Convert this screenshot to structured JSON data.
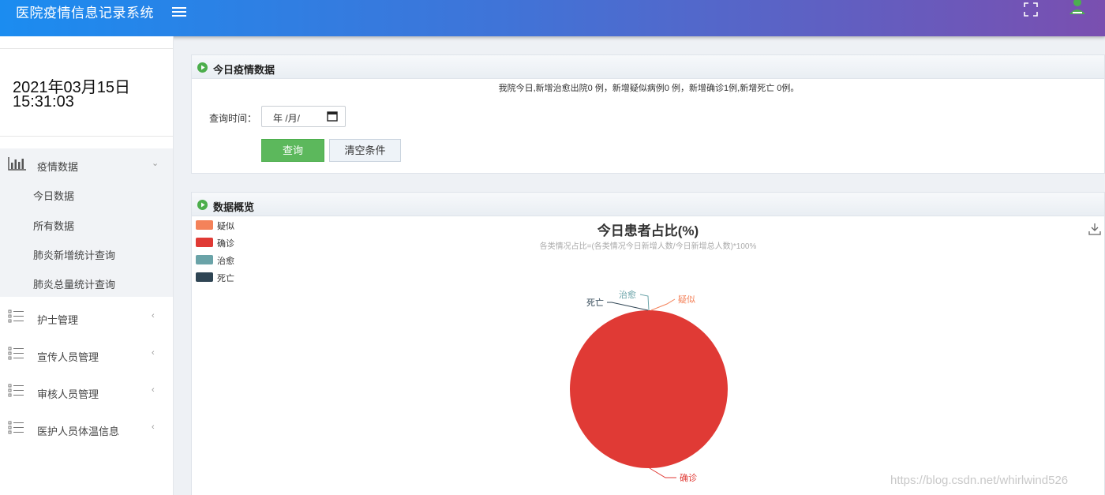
{
  "header": {
    "title": "医院疫情信息记录系统"
  },
  "sidebar": {
    "date": "2021年03月15日",
    "time": "15:31:03",
    "groups": [
      {
        "label": "疫情数据",
        "items": [
          "今日数据",
          "所有数据",
          "肺炎新增统计查询",
          "肺炎总量统计查询"
        ]
      },
      {
        "label": "护士管理"
      },
      {
        "label": "宣传人员管理"
      },
      {
        "label": "审核人员管理"
      },
      {
        "label": "医护人员体温信息"
      }
    ]
  },
  "today_panel": {
    "title": "今日疫情数据",
    "notice": "我院今日,新增治愈出院0 例，新增疑似病例0 例，新增确诊1例,新增死亡 0例。",
    "query_label": "查询时间：",
    "date_value": "年 /月/",
    "query_button": "查询",
    "clear_button": "清空条件"
  },
  "overview_panel": {
    "title": "数据概览"
  },
  "chart_data": {
    "type": "pie",
    "title": "今日患者占比(%)",
    "subtitle": "各类情况占比=(各类情况今日新增人数/今日新增总人数)*100%",
    "legend_position": "top-left",
    "categories": [
      "疑似",
      "确诊",
      "治愈",
      "死亡"
    ],
    "values": [
      0,
      100,
      0,
      0
    ],
    "colors": [
      "#f4825a",
      "#e03a35",
      "#6aa3a8",
      "#2f4554"
    ]
  },
  "watermark": "https://blog.csdn.net/whirlwind526"
}
